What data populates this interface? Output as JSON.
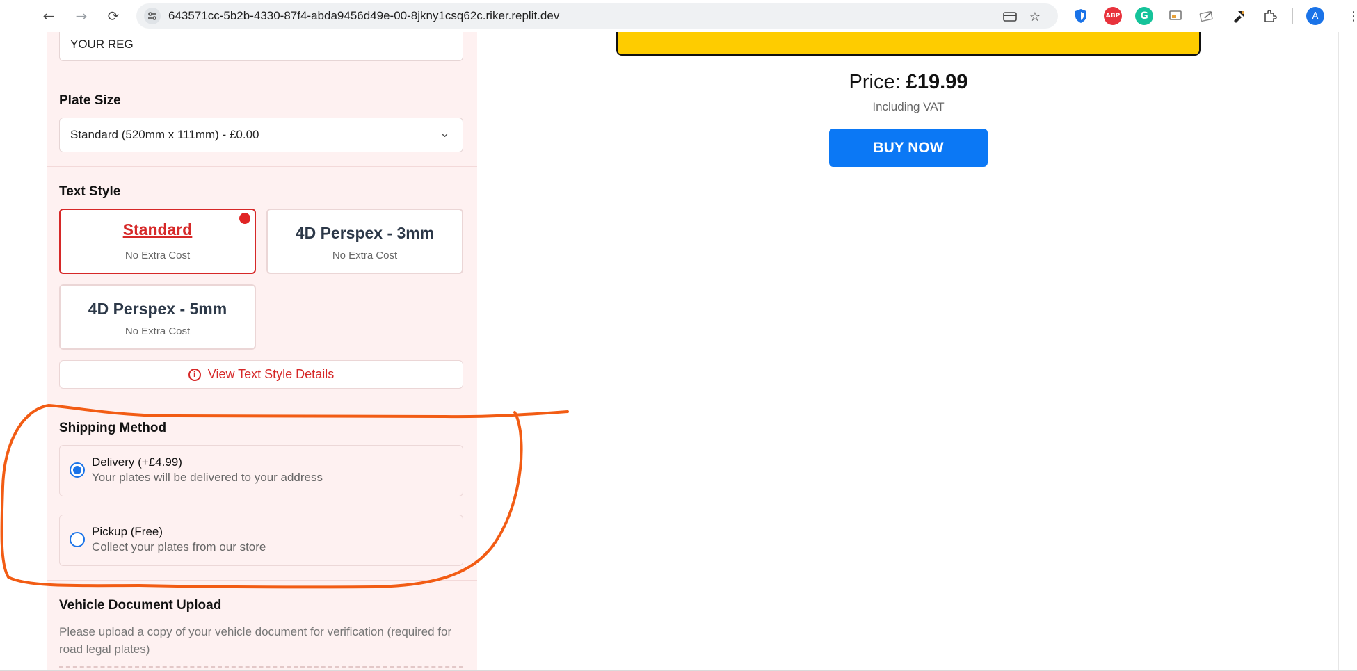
{
  "browser": {
    "url": "643571cc-5b2b-4330-87f4-abda9456d49e-00-8jkny1csq62c.riker.replit.dev",
    "profile_initial": "A",
    "ext_abp_label": "ABP",
    "ext_g_label": "G"
  },
  "form": {
    "reg_value": "YOUR REG",
    "plate_size": {
      "label": "Plate Size",
      "selected": "Standard (520mm x 111mm) - £0.00"
    },
    "text_style": {
      "label": "Text Style",
      "options": [
        {
          "name": "Standard",
          "cost": "No Extra Cost",
          "selected": true
        },
        {
          "name": "4D Perspex - 3mm",
          "cost": "No Extra Cost",
          "selected": false
        },
        {
          "name": "4D Perspex - 5mm",
          "cost": "No Extra Cost",
          "selected": false
        }
      ],
      "details_label": "View Text Style Details"
    },
    "shipping": {
      "label": "Shipping Method",
      "options": [
        {
          "title": "Delivery (+£4.99)",
          "desc": "Your plates will be delivered to your address",
          "selected": true
        },
        {
          "title": "Pickup (Free)",
          "desc": "Collect your plates from our store",
          "selected": false
        }
      ]
    },
    "upload": {
      "label": "Vehicle Document Upload",
      "desc": "Please upload a copy of your vehicle document for verification (required for road legal plates)"
    }
  },
  "summary": {
    "price_label": "Price:",
    "price_value": "£19.99",
    "vat_note": "Including VAT",
    "buy_label": "BUY NOW"
  },
  "colors": {
    "accent_red": "#d62828",
    "buy_blue": "#0b78f5",
    "plate_yellow": "#fecc00",
    "annotation_orange": "#f25c14",
    "panel_pink": "#fef1f1"
  }
}
